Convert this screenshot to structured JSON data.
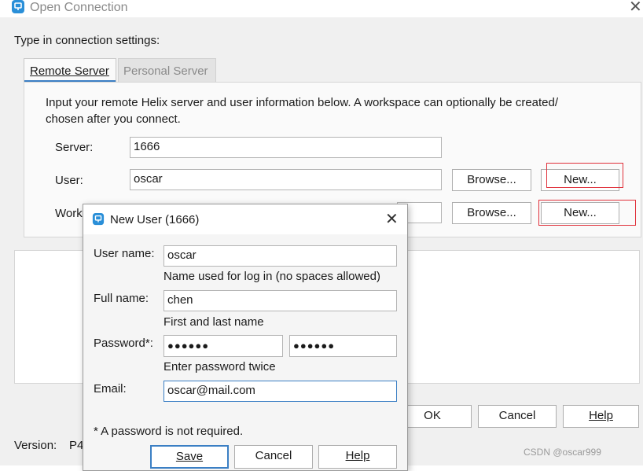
{
  "main_dialog": {
    "title": "Open Connection",
    "intro": "Type in connection settings:",
    "tabs": [
      "Remote Server",
      "Personal Server"
    ],
    "description_line1": "Input your remote Helix server and user information below. A workspace can optionally be created/",
    "description_line2": "chosen after you connect.",
    "server_label": "Server:",
    "server_value": "1666",
    "user_label": "User:",
    "user_value": "oscar",
    "workspace_label_visible": "Work",
    "browse_label": "Browse...",
    "new_label": "New...",
    "ok_label": "OK",
    "cancel_label": "Cancel",
    "help_label": "Help",
    "version_label": "Version:",
    "version_value": "P4"
  },
  "new_user_dialog": {
    "title": "New User (1666)",
    "user_name_label": "User name:",
    "user_name_value": "oscar",
    "user_name_hint": "Name used for log in (no spaces allowed)",
    "full_name_label": "Full name:",
    "full_name_value": "chen",
    "full_name_hint": "First and last name",
    "password_label": "Password*:",
    "password_value": "●●●●●●",
    "password_confirm_value": "●●●●●●",
    "password_hint": "Enter password twice",
    "email_label": "Email:",
    "email_value": "oscar@mail.com",
    "footnote": "* A password is not required.",
    "save_label": "Save",
    "cancel_label": "Cancel",
    "help_label": "Help"
  },
  "watermark": "CSDN @oscar999",
  "colors": {
    "accent": "#3b7fc4",
    "highlight_box": "#e0303a",
    "app_icon": "#2a8fd8"
  },
  "icons": {
    "app": "helix-app-icon",
    "close": "close-icon"
  }
}
